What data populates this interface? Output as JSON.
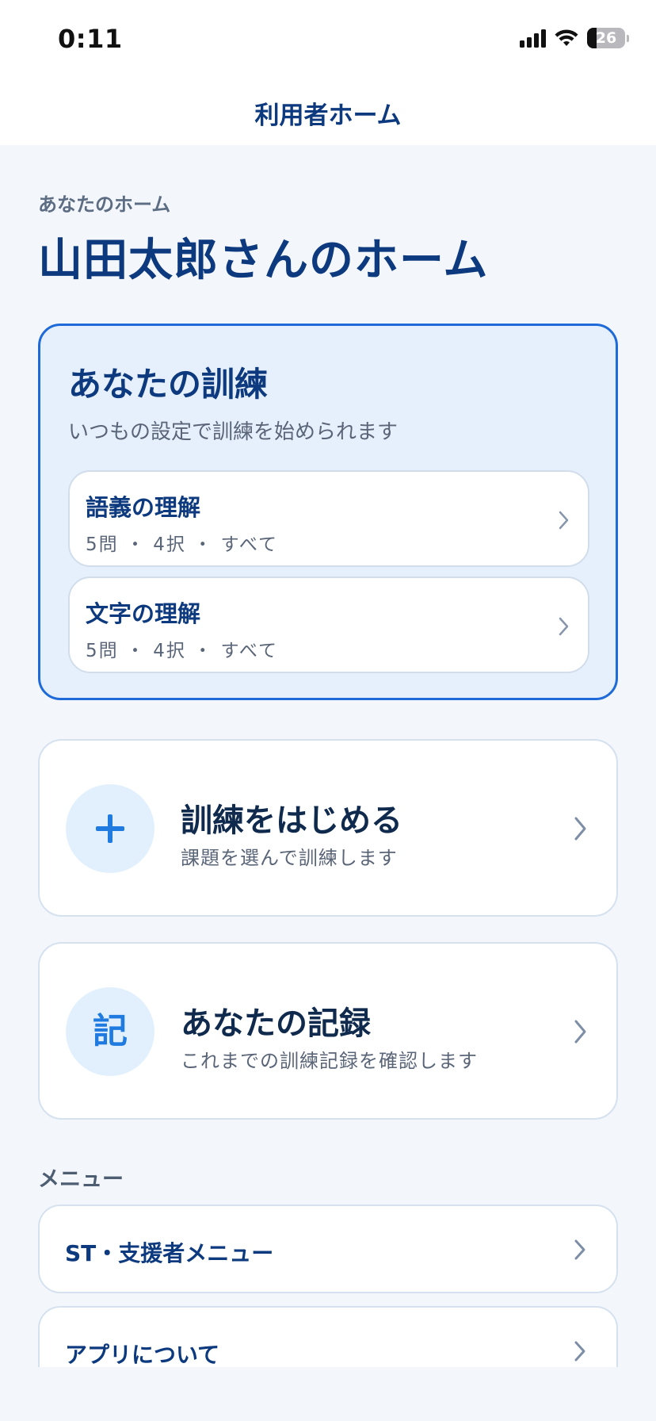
{
  "status_bar": {
    "time": "0:11",
    "battery_level": "26",
    "battery_fraction": 0.26
  },
  "header": {
    "title": "利用者ホーム"
  },
  "home": {
    "subtitle": "あなたのホーム",
    "title": "山田太郎さんのホーム"
  },
  "training": {
    "title": "あなたの訓練",
    "description": "いつもの設定で訓練を始められます",
    "presets": [
      {
        "name": "語義の理解",
        "meta": "5問 ・ 4択 ・ すべて"
      },
      {
        "name": "文字の理解",
        "meta": "5問 ・ 4択 ・ すべて"
      }
    ]
  },
  "actions": {
    "start": {
      "icon": "plus-icon",
      "title": "訓練をはじめる",
      "description": "課題を選んで訓練します"
    },
    "records": {
      "icon_text": "記",
      "title": "あなたの記録",
      "description": "これまでの訓練記録を確認します"
    }
  },
  "menu": {
    "heading": "メニュー",
    "items": [
      {
        "label": "ST・支援者メニュー"
      },
      {
        "label": "アプリについて"
      }
    ]
  },
  "colors": {
    "accent": "#1e6ad8",
    "title": "#0d3a7e",
    "icon_bg": "#e2f0fd",
    "background": "#f3f6fb"
  }
}
